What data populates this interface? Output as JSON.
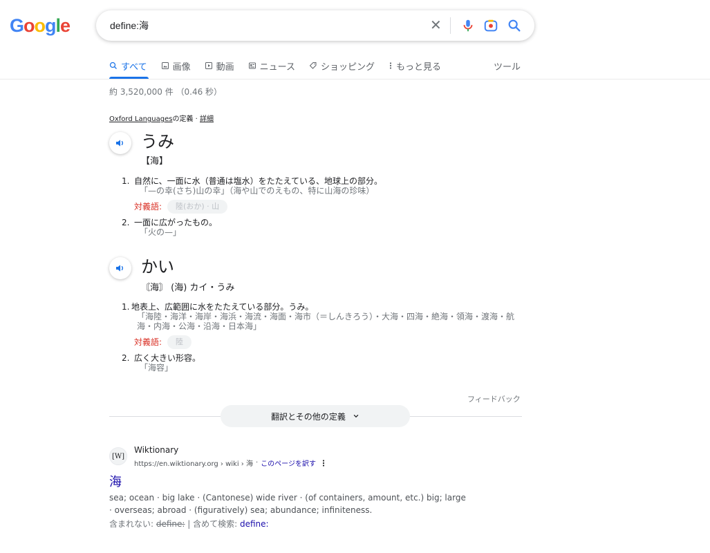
{
  "logo": {
    "g1": "G",
    "o1": "o",
    "o2": "o",
    "g2": "g",
    "l": "l",
    "e": "e"
  },
  "search": {
    "query": "define:海",
    "clear": "✕"
  },
  "tabs": [
    {
      "icon": "search-icon",
      "label": "すべて"
    },
    {
      "icon": "image-icon",
      "label": "画像"
    },
    {
      "icon": "video-icon",
      "label": "動画"
    },
    {
      "icon": "news-icon",
      "label": "ニュース"
    },
    {
      "icon": "tag-icon",
      "label": "ショッピング"
    },
    {
      "icon": "more-vert-icon",
      "label": "もっと見る"
    }
  ],
  "tools": "ツール",
  "stats": "約 3,520,000 件 （0.46 秒）",
  "source": {
    "provider": "Oxford Languages",
    "suffix": "の定義 · ",
    "details": "詳細"
  },
  "entries": [
    {
      "word": "うみ",
      "sub": "【海】",
      "defs": [
        {
          "num": "1.",
          "main": "自然に、一面に水（普通は塩水）をたたえている、地球上の部分。",
          "ex": "「—の幸(さち)山の幸」（海や山でのえもの、特に山海の珍味）",
          "antonym_label": "対義語:",
          "antonym": "陸(おか) · 山"
        },
        {
          "num": "2.",
          "main": "一面に広がったもの。",
          "ex": "「火の—」"
        }
      ]
    },
    {
      "word": "かい",
      "sub": "〘海〙 (海) カイ・うみ",
      "defs": [
        {
          "num": "1.",
          "main": "地表上、広範囲に水をたたえている部分。うみ。",
          "ex": "「海陸・海洋・海岸・海浜・海流・海面・海市（＝しんきろう）・大海・四海・絶海・領海・渡海・航海・内海・公海・沿海・日本海」",
          "antonym_label": "対義語:",
          "antonym": "陸"
        },
        {
          "num": "2.",
          "main": "広く大きい形容。",
          "ex": "「海容」"
        }
      ]
    }
  ],
  "feedback": "フィードバック",
  "expand": {
    "label": "翻訳とその他の定義",
    "chevron": "⌄"
  },
  "result": {
    "favicon": "[W]",
    "site": "Wiktionary",
    "url": "https://en.wiktionary.org › wiki › 海",
    "translate": "このページを訳す",
    "title": "海",
    "snippet": "sea; ocean · big lake · (Cantonese) wide river · (of containers, amount, etc.) big; large · overseas; abroad · (figuratively) sea; abundance; infiniteness.",
    "missing_label": "含まれない: ",
    "missing_term": "define:",
    "with_label": " | 含めて検索: ",
    "with_term": "define:"
  }
}
